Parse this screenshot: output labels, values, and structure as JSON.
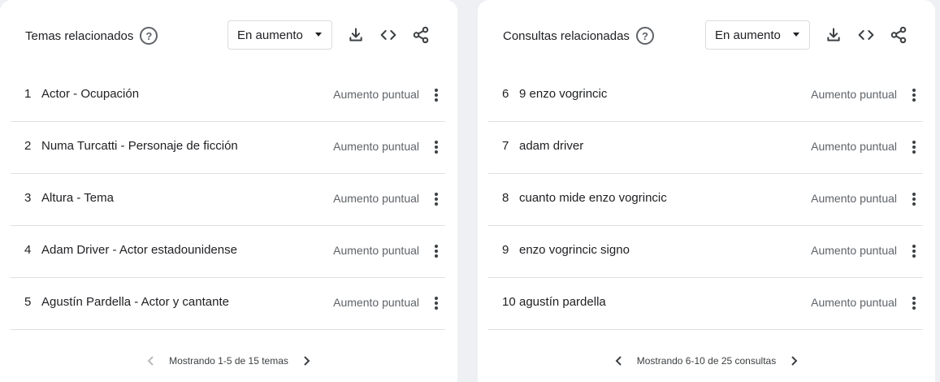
{
  "panels": [
    {
      "title": "Temas relacionados",
      "help_symbol": "?",
      "filter": "En aumento",
      "icons": [
        "download-icon",
        "embed-code-icon",
        "share-icon"
      ],
      "rows": [
        {
          "rank": "1",
          "label": "Actor - Ocupación",
          "value": "Aumento puntual"
        },
        {
          "rank": "2",
          "label": "Numa Turcatti - Personaje de ficción",
          "value": "Aumento puntual"
        },
        {
          "rank": "3",
          "label": "Altura - Tema",
          "value": "Aumento puntual"
        },
        {
          "rank": "4",
          "label": "Adam Driver - Actor estadounidense",
          "value": "Aumento puntual"
        },
        {
          "rank": "5",
          "label": "Agustín Pardella - Actor y cantante",
          "value": "Aumento puntual"
        }
      ],
      "pagination": {
        "text": "Mostrando 1-5 de 15 temas",
        "prev_enabled": false,
        "next_enabled": true
      }
    },
    {
      "title": "Consultas relacionadas",
      "help_symbol": "?",
      "filter": "En aumento",
      "icons": [
        "download-icon",
        "embed-code-icon",
        "share-icon"
      ],
      "rows": [
        {
          "rank": "6",
          "label": "9 enzo vogrincic",
          "value": "Aumento puntual"
        },
        {
          "rank": "7",
          "label": "adam driver",
          "value": "Aumento puntual"
        },
        {
          "rank": "8",
          "label": "cuanto mide enzo vogrincic",
          "value": "Aumento puntual"
        },
        {
          "rank": "9",
          "label": "enzo vogrincic signo",
          "value": "Aumento puntual"
        },
        {
          "rank": "10",
          "label": "agustín pardella",
          "value": "Aumento puntual"
        }
      ],
      "pagination": {
        "text": "Mostrando 6-10 de 25 consultas",
        "prev_enabled": true,
        "next_enabled": true
      }
    }
  ],
  "colors": {
    "background": "#eef0f3",
    "card": "#ffffff",
    "divider": "#e0e0e0",
    "muted_text": "#5f6368",
    "icon": "#3c4043"
  }
}
